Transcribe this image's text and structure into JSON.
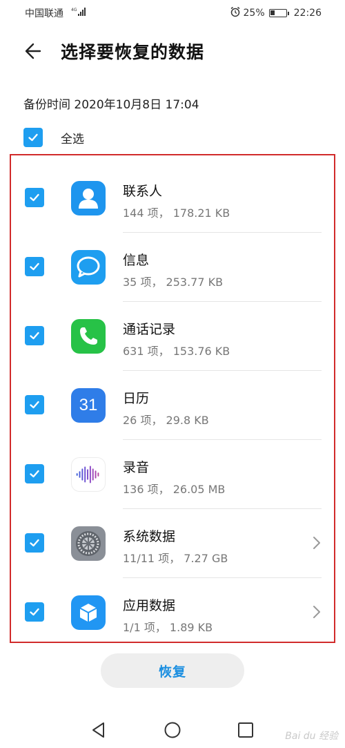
{
  "status_bar": {
    "carrier": "中国联通",
    "network": "4G",
    "battery": "25%",
    "time": "22:26"
  },
  "header": {
    "title": "选择要恢复的数据"
  },
  "backup_time": "备份时间 2020年10月8日 17:04",
  "select_all": {
    "label": "全选",
    "checked": true
  },
  "items": [
    {
      "name": "联系人",
      "detail": "144 项， 178.21 KB",
      "icon": "contacts-icon",
      "checked": true,
      "has_chevron": false
    },
    {
      "name": "信息",
      "detail": "35 项， 253.77 KB",
      "icon": "messages-icon",
      "checked": true,
      "has_chevron": false
    },
    {
      "name": "通话记录",
      "detail": "631 项， 153.76 KB",
      "icon": "phone-icon",
      "checked": true,
      "has_chevron": false
    },
    {
      "name": "日历",
      "detail": "26 项， 29.8 KB",
      "icon": "calendar-icon",
      "icon_text": "31",
      "checked": true,
      "has_chevron": false
    },
    {
      "name": "录音",
      "detail": "136 项， 26.05 MB",
      "icon": "recorder-icon",
      "checked": true,
      "has_chevron": false
    },
    {
      "name": "系统数据",
      "detail": "11/11 项， 7.27 GB",
      "icon": "system-settings-icon",
      "checked": true,
      "has_chevron": true
    },
    {
      "name": "应用数据",
      "detail": "1/1 项， 1.89 KB",
      "icon": "app-data-icon",
      "checked": true,
      "has_chevron": true
    }
  ],
  "restore_button": "恢复",
  "watermark": "Bai du 经验",
  "colors": {
    "accent": "#1e9ef0",
    "highlight_frame": "#d12a2a",
    "button_text": "#1a8ee0"
  }
}
